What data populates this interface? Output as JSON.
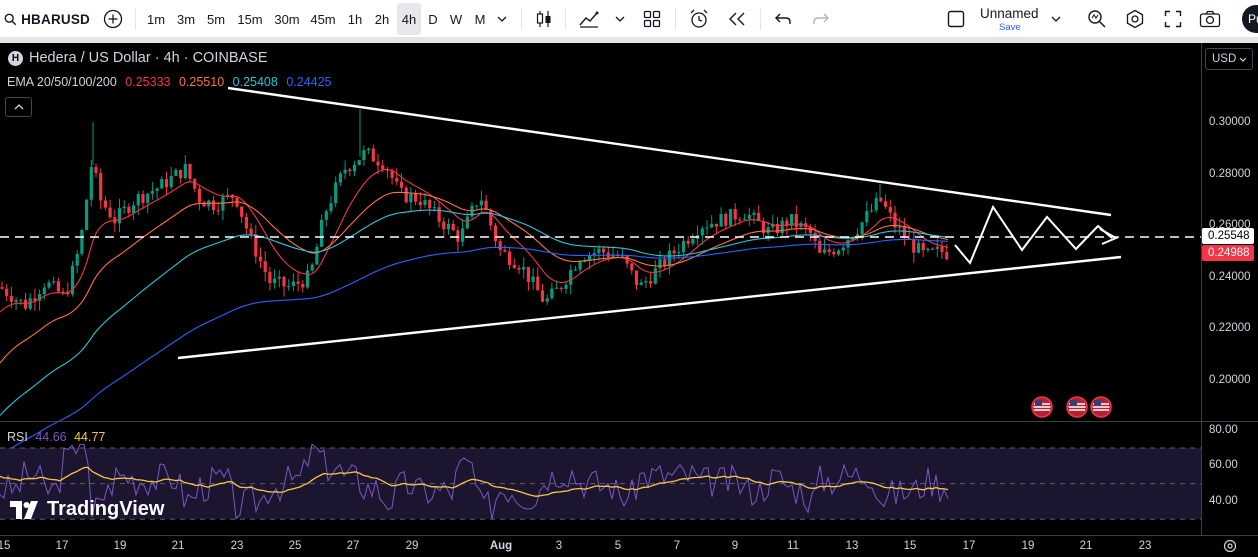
{
  "toolbar": {
    "symbol": "HBARUSD",
    "intervals": [
      "1m",
      "3m",
      "5m",
      "15m",
      "30m",
      "45m",
      "1h",
      "2h",
      "4h",
      "D",
      "W",
      "M"
    ],
    "selected_interval": "4h",
    "layout_name": "Unnamed",
    "layout_save": "Save",
    "publish_label": "Pu"
  },
  "legend": {
    "title": "Hedera / US Dollar · 4h · COINBASE",
    "symbol_badge": "H",
    "ema_label": "EMA 20/50/100/200",
    "ema_values": [
      {
        "value": "0.25333",
        "color": "#f23645"
      },
      {
        "value": "0.25510",
        "color": "#ff7043"
      },
      {
        "value": "0.25408",
        "color": "#26c6da"
      },
      {
        "value": "0.24425",
        "color": "#2962ff"
      }
    ]
  },
  "currency": "USD",
  "price_axis": {
    "labels": [
      "0.30000",
      "0.28000",
      "0.26000",
      "0.24000",
      "0.22000",
      "0.20000"
    ],
    "current_price_tag": "0.25548",
    "last_price_tag": "0.24988"
  },
  "rsi": {
    "label": "RSI",
    "value": "44.66",
    "ma_value": "44.77",
    "value_color": "#7e57c2",
    "ma_color": "#f7c544",
    "axis_labels": [
      "80.00",
      "60.00",
      "40.00"
    ]
  },
  "time_axis": {
    "labels": [
      {
        "text": "15",
        "bold": false
      },
      {
        "text": "17",
        "bold": false
      },
      {
        "text": "19",
        "bold": false
      },
      {
        "text": "21",
        "bold": false
      },
      {
        "text": "23",
        "bold": false
      },
      {
        "text": "25",
        "bold": false
      },
      {
        "text": "27",
        "bold": false
      },
      {
        "text": "29",
        "bold": false
      },
      {
        "text": "Aug",
        "bold": true
      },
      {
        "text": "3",
        "bold": false
      },
      {
        "text": "5",
        "bold": false
      },
      {
        "text": "7",
        "bold": false
      },
      {
        "text": "9",
        "bold": false
      },
      {
        "text": "11",
        "bold": false
      },
      {
        "text": "13",
        "bold": false
      },
      {
        "text": "15",
        "bold": false
      },
      {
        "text": "17",
        "bold": false
      },
      {
        "text": "19",
        "bold": false
      },
      {
        "text": "21",
        "bold": false
      },
      {
        "text": "23",
        "bold": false
      }
    ]
  },
  "watermark": "TradingView",
  "colors": {
    "up": "#089981",
    "down": "#f23645",
    "background": "#000000",
    "drawing": "#ffffff"
  },
  "chart_data": {
    "type": "candlestick",
    "title": "Hedera / US Dollar · 4h · COINBASE",
    "ylim": [
      0.19,
      0.31
    ],
    "annotations": [
      "symmetrical triangle drawing",
      "zig-zag projected path",
      "dashed horizontal line at 0.25548"
    ],
    "series": [
      {
        "name": "EMA 20",
        "last": 0.25333
      },
      {
        "name": "EMA 50",
        "last": 0.2551
      },
      {
        "name": "EMA 100",
        "last": 0.25408
      },
      {
        "name": "EMA 200",
        "last": 0.24425
      }
    ]
  }
}
